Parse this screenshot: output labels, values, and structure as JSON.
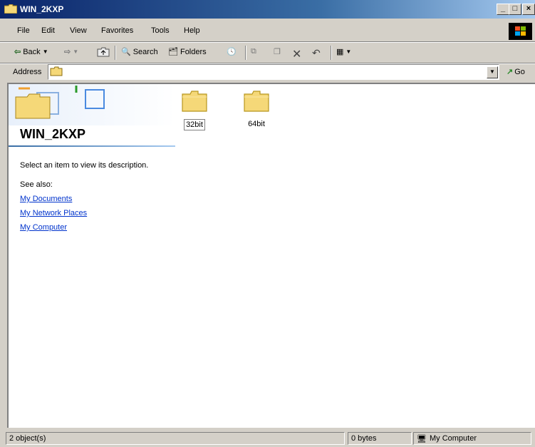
{
  "window": {
    "title": "WIN_2KXP"
  },
  "menu": [
    "File",
    "Edit",
    "View",
    "Favorites",
    "Tools",
    "Help"
  ],
  "toolbar": {
    "back": "Back",
    "search": "Search",
    "folders": "Folders"
  },
  "address": {
    "label": "Address",
    "go": "Go"
  },
  "panel": {
    "title": "WIN_2KXP",
    "description": "Select an item to view its description.",
    "see_also": "See also:",
    "links": [
      "My Documents",
      "My Network Places",
      "My Computer"
    ]
  },
  "files": [
    {
      "name": "32bit",
      "selected": true
    },
    {
      "name": "64bit",
      "selected": false
    }
  ],
  "status": {
    "objects": "2 object(s)",
    "size": "0 bytes",
    "zone": "My Computer"
  },
  "colors": {
    "titlebar": "#0a246a",
    "link": "#0033cc",
    "folder": "#f5d878"
  }
}
